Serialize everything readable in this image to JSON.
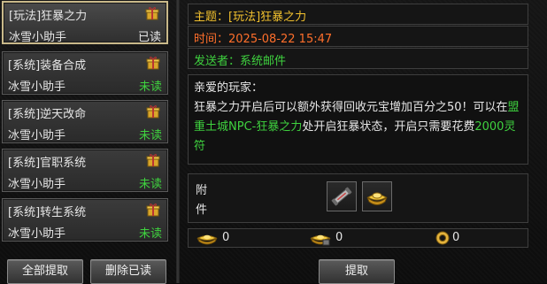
{
  "mail_list": [
    {
      "subject": "[玩法]狂暴之力",
      "sender": "冰雪小助手",
      "status": "已读",
      "read": true,
      "selected": true
    },
    {
      "subject": "[系统]装备合成",
      "sender": "冰雪小助手",
      "status": "未读",
      "read": false,
      "selected": false
    },
    {
      "subject": "[系统]逆天改命",
      "sender": "冰雪小助手",
      "status": "未读",
      "read": false,
      "selected": false
    },
    {
      "subject": "[系统]官职系统",
      "sender": "冰雪小助手",
      "status": "未读",
      "read": false,
      "selected": false
    },
    {
      "subject": "[系统]转生系统",
      "sender": "冰雪小助手",
      "status": "未读",
      "read": false,
      "selected": false
    }
  ],
  "detail": {
    "subject": "主题：[玩法]狂暴之力",
    "time": "时间：2025-08-22 15:47",
    "sender": "发送者：系统邮件",
    "greeting": "亲爱的玩家：",
    "body_part1": "狂暴之力开启后可以额外获得回收元宝增加百分之50！可以在",
    "body_place": "盟重土城NPC-狂暴之力",
    "body_part2": "处开启狂暴状态，开启只需要花费",
    "body_amount": "2000灵符",
    "attach_label": "附件"
  },
  "totals": [
    {
      "icon": "gold-ingot-icon",
      "value": "0"
    },
    {
      "icon": "bound-ingot-icon",
      "value": "0"
    },
    {
      "icon": "coin-icon",
      "value": "0"
    }
  ],
  "buttons": {
    "claim_all": "全部提取",
    "delete_read": "删除已读",
    "claim": "提取"
  },
  "colors": {
    "subject": "#f2c12e",
    "time": "#ff6f2b",
    "green": "#3fd23f",
    "selected_border": "#c9b98a"
  }
}
